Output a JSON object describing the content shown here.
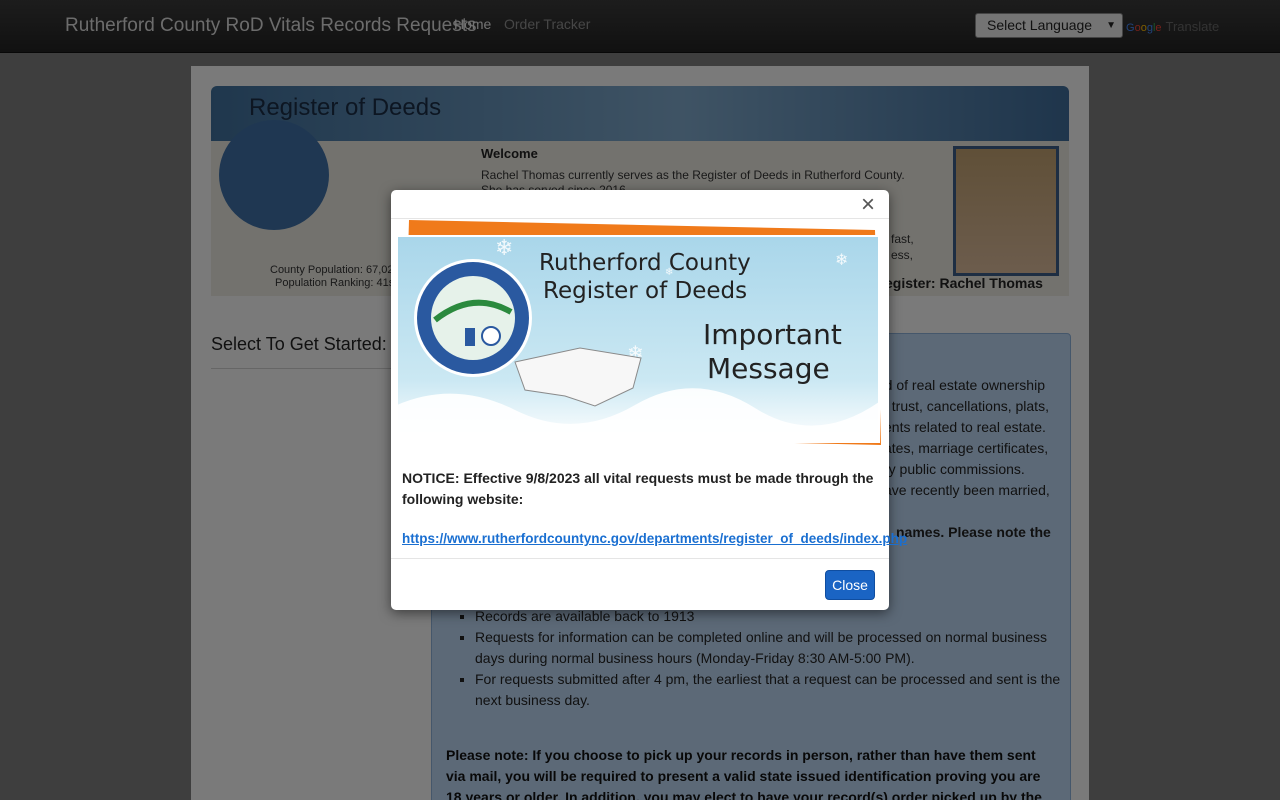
{
  "navbar": {
    "brand": "Rutherford County RoD Vitals Records Requests",
    "links": [
      "Home",
      "Order Tracker"
    ],
    "language_select": "Select Language",
    "google": "Google",
    "translate": "Translate"
  },
  "banner": {
    "title": "Register of Deeds",
    "welcome": "Welcome",
    "welcome_text_1": "Rachel Thomas currently serves as the Register of Deeds in Rutherford County.",
    "welcome_text_2": "She has served since 2016",
    "frag_fast": "fast,",
    "frag_ess": "ess,",
    "county_population": "County Population:  67,02",
    "population_ranking": "Population Ranking:  41s",
    "register_label": "egister:  Rachel Thomas"
  },
  "main": {
    "select_title": "Select To Get Started:",
    "frags": [
      "rd of real estate ownership",
      "f trust, cancellations, plats,",
      "ents related to real estate.",
      "ates, marriage certificates,",
      "ry public commissions.",
      "ave recently been married,",
      "names. Please note the"
    ],
    "list": [
      "Records are available back to 1913",
      "Requests for information can be completed online and will be processed on normal business days during normal business hours (Monday-Friday 8:30 AM-5:00 PM).",
      "For requests submitted after 4 pm, the earliest that a request can be processed and sent is the next business day."
    ],
    "note": "Please note: If you choose to pick up your records in person, rather than have them sent via mail, you will be required to present a valid state issued identification proving you are 18 years or older. In addition, you may elect to have your record(s) order picked up by the"
  },
  "modal": {
    "close_x": "×",
    "image": {
      "line1": "Rutherford County",
      "line2": "Register of Deeds",
      "line3": "Important",
      "line4": "Message"
    },
    "notice": "NOTICE: Effective 9/8/2023 all vital requests must be made through the following website:",
    "link": "https://www.rutherfordcountync.gov/departments/register_of_deeds/index.php",
    "close_button": "Close"
  },
  "colors": {
    "accent": "#1a64c4",
    "navbar": "#2a2a2a",
    "link": "#1a6fd1"
  }
}
